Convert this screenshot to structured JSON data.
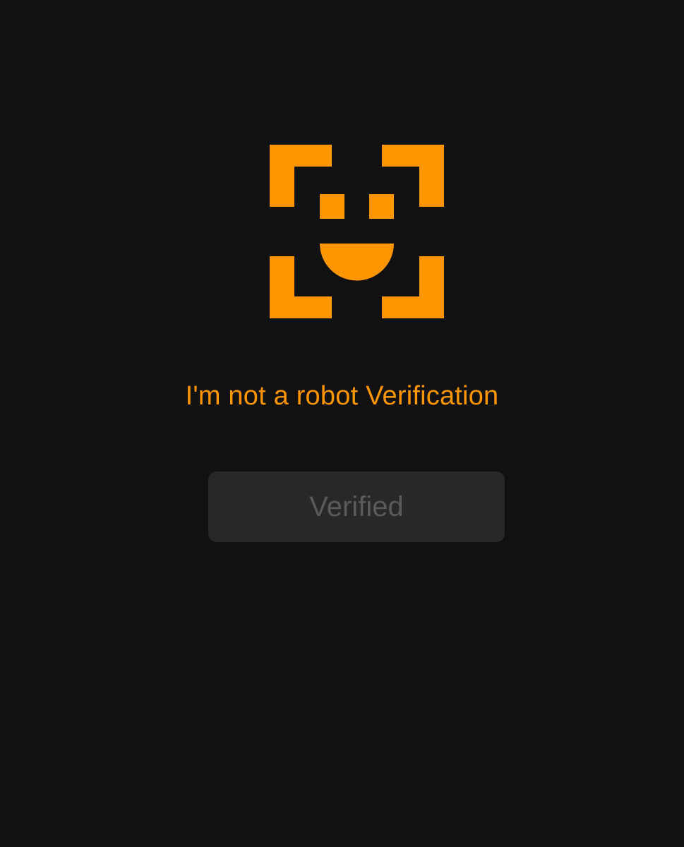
{
  "title": "I'm not a robot Verification",
  "button": {
    "label": "Verified",
    "state": "disabled"
  },
  "icon": {
    "name": "face-scan-icon",
    "color": "#FF9500"
  },
  "colors": {
    "background": "#111111",
    "accent": "#FF9500",
    "button_bg": "#282828",
    "button_text": "#5a5a5a"
  }
}
